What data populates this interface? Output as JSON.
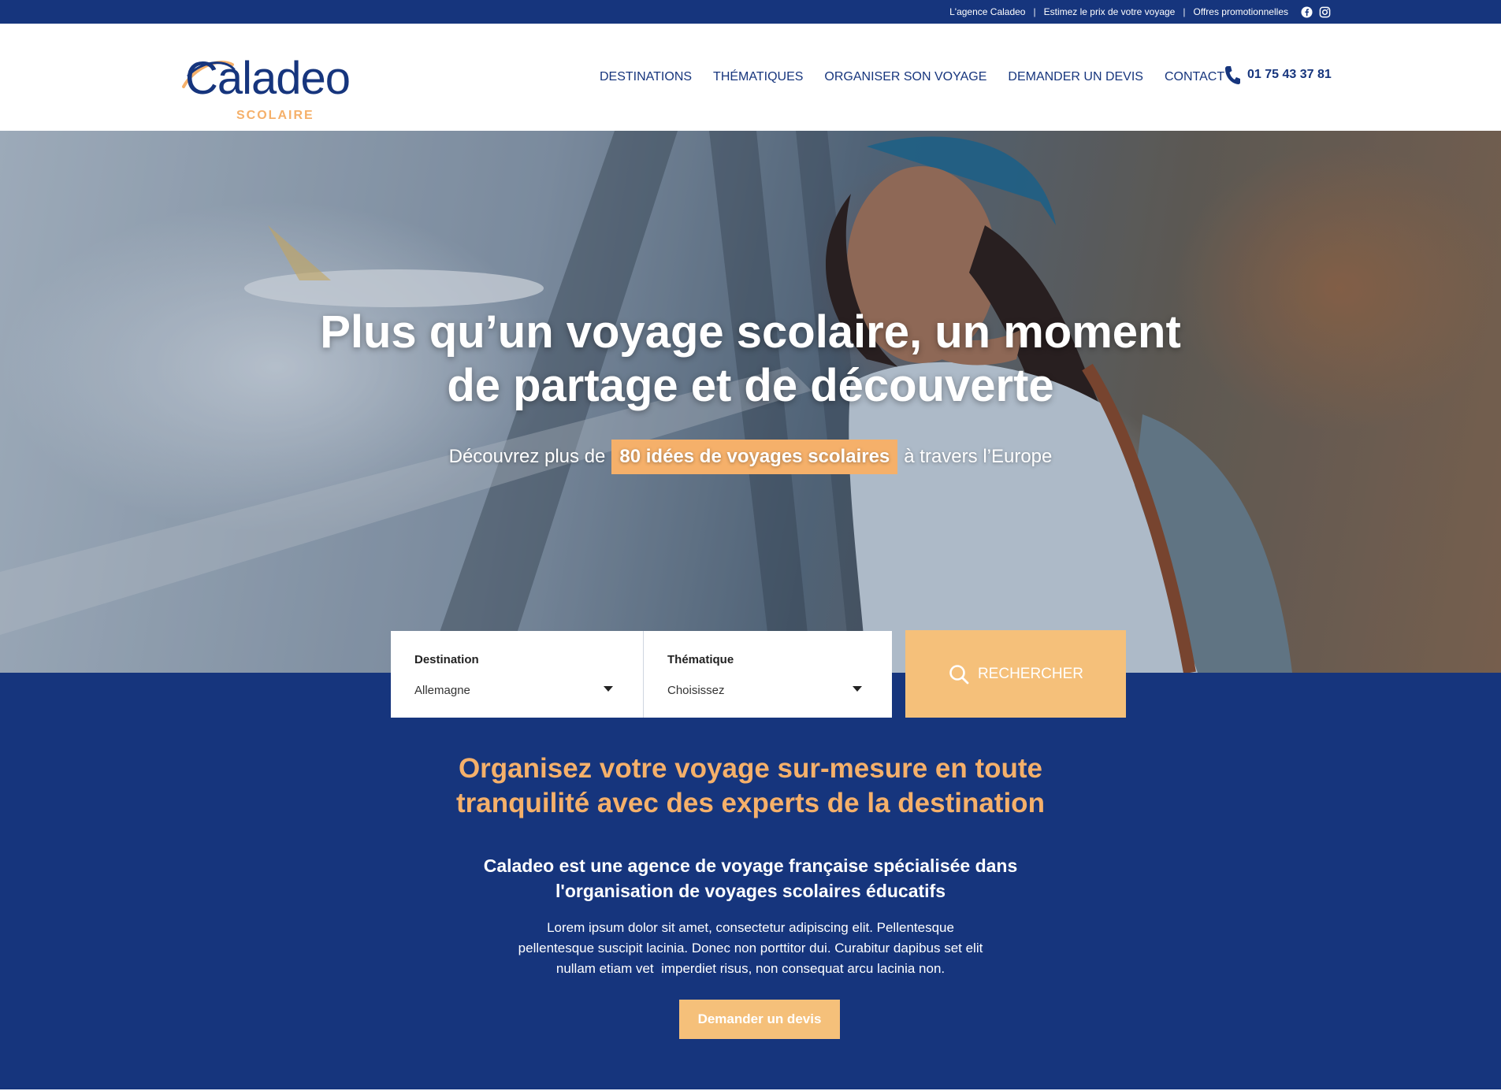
{
  "topbar": {
    "links": [
      "L'agence Caladeo",
      "Estimez le prix de votre voyage",
      "Offres promotionnelles"
    ],
    "separator": "|",
    "social": [
      "facebook-icon",
      "instagram-icon"
    ]
  },
  "header": {
    "logo_word": "Caladeo",
    "logo_sub": "SCOLAIRE",
    "nav": [
      "DESTINATIONS",
      "THÉMATIQUES",
      "ORGANISER SON VOYAGE",
      "DEMANDER UN DEVIS",
      "CONTACT"
    ],
    "phone": "01 75 43 37 81"
  },
  "hero": {
    "title_line1": "Plus qu’un voyage scolaire, un moment",
    "title_line2": "de partage et de découverte",
    "sub_before": "Découvrez plus de",
    "sub_highlight": "80 idées de voyages scolaires",
    "sub_after": "à travers l’Europe"
  },
  "search": {
    "destination_label": "Destination",
    "destination_value": "Allemagne",
    "theme_label": "Thématique",
    "theme_value": "Choisissez",
    "button_label": "RECHERCHER"
  },
  "lower": {
    "title_line1": "Organisez votre voyage sur-mesure en toute",
    "title_line2": "tranquilité avec des experts de la destination",
    "sub_line1": "Caladeo est une agence de voyage française spécialisée dans",
    "sub_line2": "l'organisation de voyages scolaires éducatifs",
    "body_line1": "Lorem ipsum dolor sit amet, consectetur adipiscing elit. Pellentesque",
    "body_line2": "pellentesque suscipit lacinia. Donec non porttitor dui. Curabitur dapibus set elit",
    "body_line3": "nullam etiam vet  imperdiet risus, non consequat arcu lacinia non.",
    "cta_label": "Demander un devis"
  },
  "colors": {
    "brand_blue": "#16357d",
    "accent_orange": "#f5b06a",
    "button_orange": "#f5c07a"
  }
}
